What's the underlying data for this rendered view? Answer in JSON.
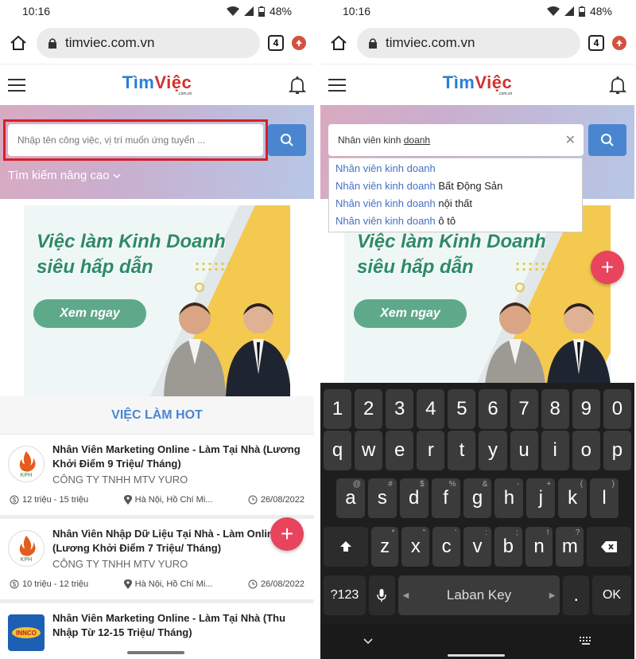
{
  "status": {
    "time": "10:16",
    "battery": "48%"
  },
  "browser": {
    "url": "timviec.com.vn",
    "tab_count": "4"
  },
  "site": {
    "logo_part1": "Tìm",
    "logo_part2": "Việc",
    "logo_sub": ".com.vn"
  },
  "search": {
    "placeholder": "Nhập tên công việc, vị trí muốn ứng tuyển ...",
    "value_prefix": "Nhân viên kinh ",
    "value_underlined": "doanh",
    "advanced_label": "Tìm kiếm nâng cao"
  },
  "suggestions": [
    {
      "match": "Nhân viên kinh doanh",
      "rest": ""
    },
    {
      "match": "Nhân viên kinh doanh",
      "rest": " Bất Động Sản"
    },
    {
      "match": "Nhân viên kinh doanh",
      "rest": " nội thất"
    },
    {
      "match": "Nhân viên kinh doanh",
      "rest": " ô tô"
    }
  ],
  "banner": {
    "line1": "Việc làm Kinh Doanh",
    "line2": "siêu hấp dẫn",
    "cta": "Xem ngay"
  },
  "hot_jobs": {
    "title": "VIỆC LÀM HOT",
    "items": [
      {
        "logo": "KPH",
        "title": "Nhân Viên Marketing Online - Làm Tại Nhà (Lương Khởi Điểm 9 Triệu/ Tháng)",
        "company": "CÔNG TY TNHH MTV YURO",
        "salary": "12 triệu - 15 triệu",
        "location": "Hà Nội, Hồ Chí Mi...",
        "date": "26/08/2022"
      },
      {
        "logo": "KPH",
        "title": "Nhân Viên Nhập Dữ Liệu Tại Nhà - Làm Online (Lương Khởi Điểm 7 Triệu/ Tháng)",
        "company": "CÔNG TY TNHH MTV YURO",
        "salary": "10 triệu - 12 triệu",
        "location": "Hà Nội, Hồ Chí Mi...",
        "date": "26/08/2022"
      },
      {
        "logo": "INNCO",
        "title": "Nhân Viên Marketing Online - Làm Tại Nhà (Thu Nhập Từ 12-15 Triệu/ Tháng)",
        "company": "",
        "salary": "",
        "location": "",
        "date": ""
      }
    ]
  },
  "keyboard": {
    "numbers": [
      "1",
      "2",
      "3",
      "4",
      "5",
      "6",
      "7",
      "8",
      "9",
      "0"
    ],
    "row1": [
      "q",
      "w",
      "e",
      "r",
      "t",
      "y",
      "u",
      "i",
      "o",
      "p"
    ],
    "row2": [
      {
        "k": "a",
        "s": "@"
      },
      {
        "k": "s",
        "s": "#"
      },
      {
        "k": "d",
        "s": "$"
      },
      {
        "k": "f",
        "s": "%"
      },
      {
        "k": "g",
        "s": "&"
      },
      {
        "k": "h",
        "s": "-"
      },
      {
        "k": "j",
        "s": "+"
      },
      {
        "k": "k",
        "s": "("
      },
      {
        "k": "l",
        "s": ")"
      }
    ],
    "row3": [
      {
        "k": "z",
        "s": "*"
      },
      {
        "k": "x",
        "s": "\""
      },
      {
        "k": "c",
        "s": "'"
      },
      {
        "k": "v",
        "s": ":"
      },
      {
        "k": "b",
        "s": ";"
      },
      {
        "k": "n",
        "s": "!"
      },
      {
        "k": "m",
        "s": "?"
      }
    ],
    "sym_label": "?123",
    "space_label": "Laban Key",
    "period": ".",
    "ok_label": "OK"
  }
}
